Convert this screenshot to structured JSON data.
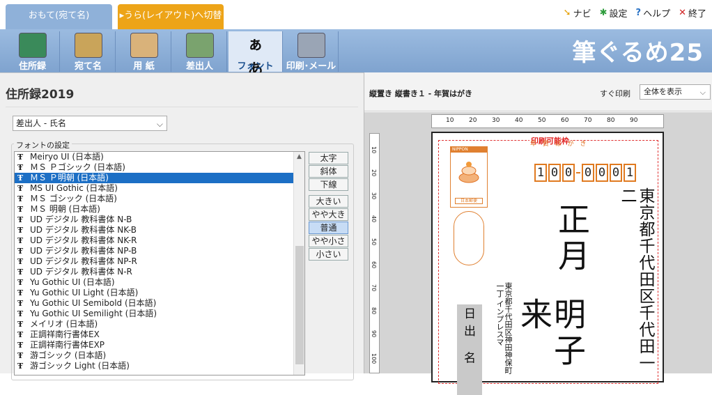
{
  "tabs": {
    "front": "おもて(宛て名)",
    "back": "▸うら(レイアウト)へ切替"
  },
  "top_menu": [
    {
      "icon": "pointer-icon",
      "label": "ナビ",
      "color": "#e6a000"
    },
    {
      "icon": "gear-icon",
      "label": "設定",
      "color": "#2e9c3c"
    },
    {
      "icon": "help-icon",
      "label": "ヘルプ",
      "color": "#2a73c6"
    },
    {
      "icon": "close-icon",
      "label": "終了",
      "color": "#d02020"
    }
  ],
  "toolbar": [
    {
      "label": "住所録",
      "icon": "address-book-icon"
    },
    {
      "label": "宛て名",
      "icon": "addressee-icon"
    },
    {
      "label": "用 紙",
      "icon": "paper-icon"
    },
    {
      "label": "差出人",
      "icon": "sender-icon"
    },
    {
      "label": "フォント",
      "icon": "font-icon",
      "glyph": "ぁあ"
    },
    {
      "label": "印刷･メール",
      "icon": "printer-icon"
    }
  ],
  "brand": "筆ぐるめ25",
  "left_panel": {
    "title": "住所録2019",
    "field_select": "差出人 - 氏名",
    "font_group_label": "フォントの設定",
    "fonts": [
      "Meiryo UI (日本語)",
      "ＭＳ Ｐゴシック (日本語)",
      "ＭＳ Ｐ明朝 (日本語)",
      "MS UI Gothic (日本語)",
      "ＭＳ ゴシック (日本語)",
      "ＭＳ 明朝 (日本語)",
      "UD デジタル 教科書体 N-B",
      "UD デジタル 教科書体 NK-B",
      "UD デジタル 教科書体 NK-R",
      "UD デジタル 教科書体 NP-B",
      "UD デジタル 教科書体 NP-R",
      "UD デジタル 教科書体 N-R",
      "Yu Gothic UI (日本語)",
      "Yu Gothic UI Light (日本語)",
      "Yu Gothic UI Semibold (日本語)",
      "Yu Gothic UI Semilight (日本語)",
      "メイリオ (日本語)",
      "正調祥南行書体EX",
      "正調祥南行書体EXP",
      "游ゴシック (日本語)",
      "游ゴシック Light (日本語)"
    ],
    "selected_font_index": 2,
    "style_buttons": [
      "太字",
      "斜体",
      "下線"
    ],
    "size_buttons": [
      "大きい",
      "やや大きい",
      "普通",
      "やや小さい",
      "小さい"
    ],
    "active_size": "普通"
  },
  "right_panel": {
    "layout_label": "縦置き 縦書き１ - 年賀はがき",
    "print_label": "すぐ印刷",
    "zoom_select": "全体を表示",
    "ruler_h": [
      "10",
      "20",
      "30",
      "40",
      "50",
      "60",
      "70",
      "80",
      "90"
    ],
    "ruler_v": [
      "10",
      "20",
      "30",
      "40",
      "50",
      "60",
      "70",
      "80",
      "90",
      "100"
    ],
    "print_area_label": "印刷可能枠",
    "nenga_label": "年 賀 は が き",
    "stamp_top": "NIPPON",
    "stamp_bottom": "日本郵便",
    "postal_code": [
      "1",
      "0",
      "0",
      "0",
      "0",
      "0",
      "1"
    ],
    "recipient_address": "東京都千代田区千代田一二",
    "recipient_name_1": "正月",
    "recipient_name_2": "明子 来",
    "sender_address_1": "東京都千代田区神田神保町一丁",
    "sender_address_2": "インプレスマ",
    "sender_name": "日出 名"
  }
}
